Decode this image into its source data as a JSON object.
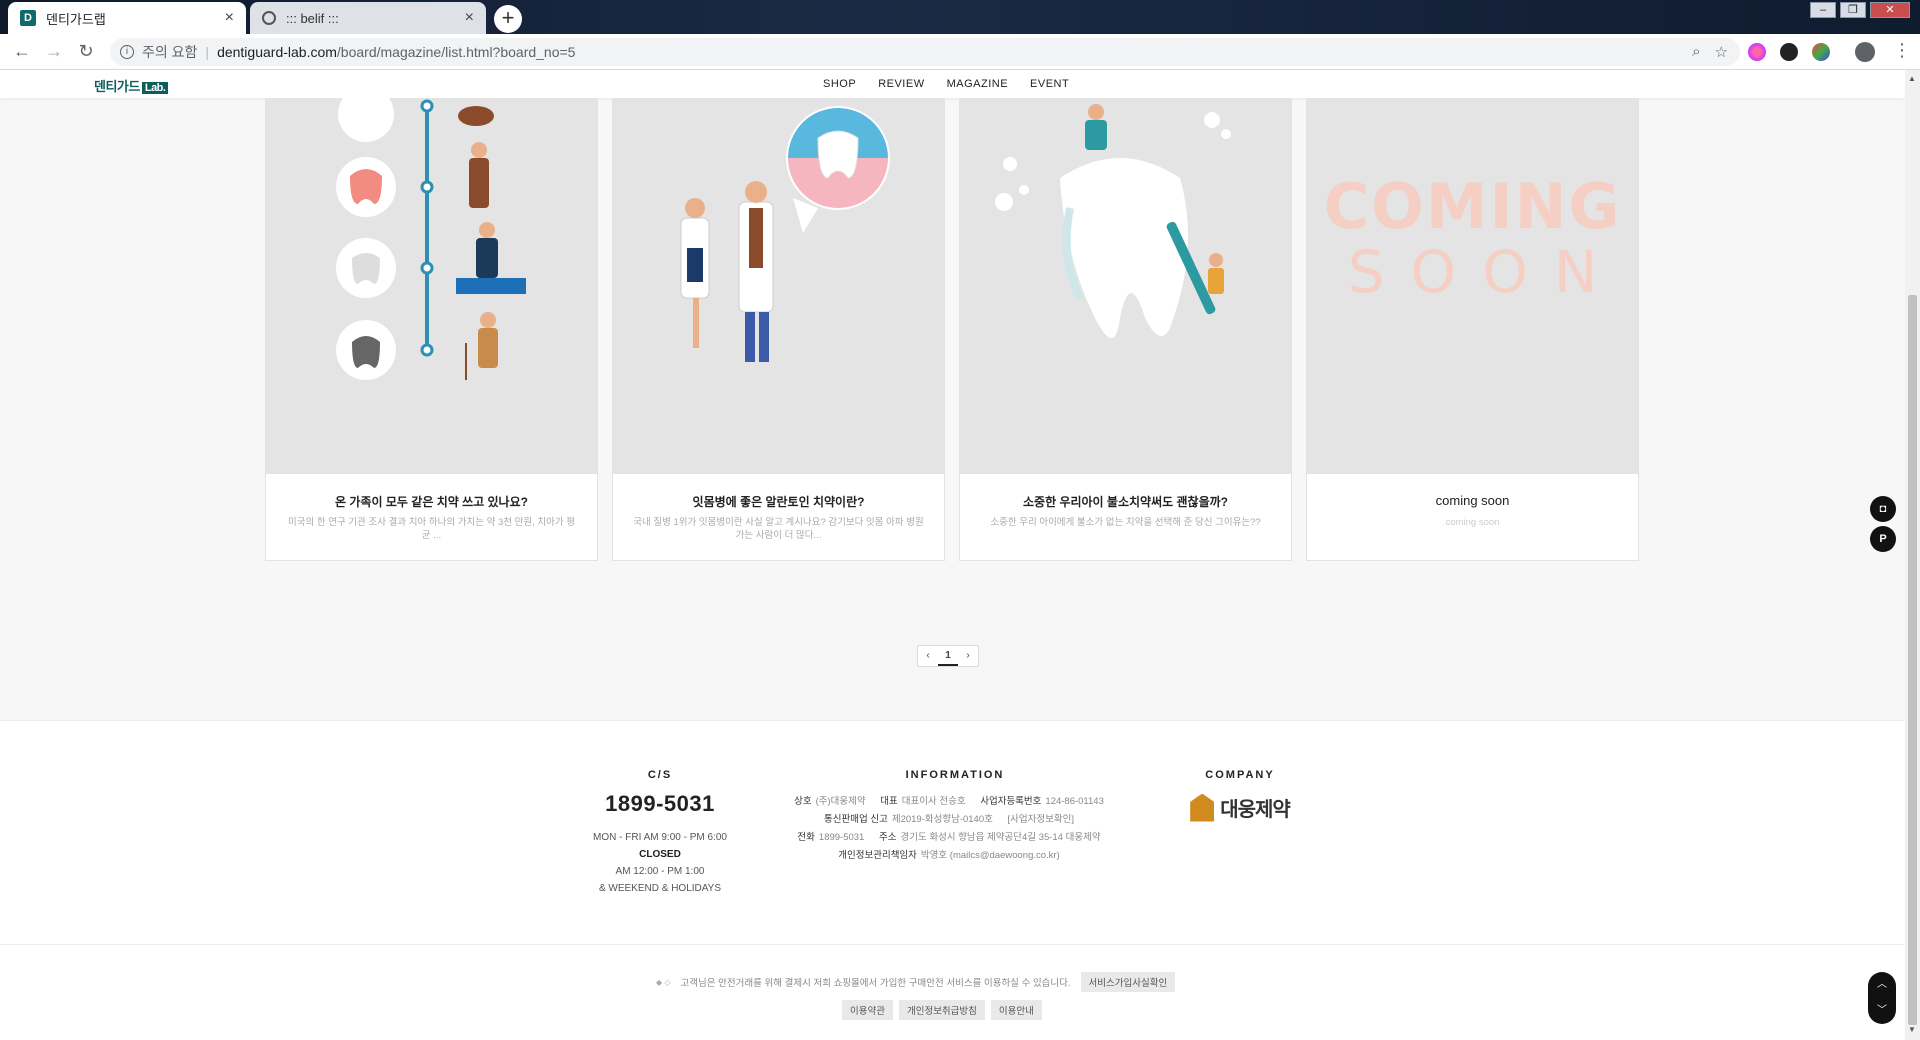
{
  "browser": {
    "tabs": [
      {
        "title": "덴티가드랩",
        "favicon": "D"
      },
      {
        "title": "::: belif :::"
      }
    ],
    "address": {
      "security_label": "주의 요함",
      "host": "dentiguard-lab.com",
      "path": "/board/magazine/list.html?board_no=5"
    }
  },
  "site": {
    "logo_text": "덴티가드",
    "logo_badge": "Lab.",
    "nav": [
      "SHOP",
      "REVIEW",
      "MAGAZINE",
      "EVENT"
    ]
  },
  "cards": [
    {
      "title": "온 가족이 모두 같은 치약 쓰고 있나요?",
      "desc": "미국의 한 연구 기관 조사 결과 치아 하나의 가치는 약 3천 만원, 치아가 평균 ..."
    },
    {
      "title": "잇몸병에 좋은 알란토인 치약이란?",
      "desc": "국내 질병 1위가 잇몸병이란 사실 알고 계시나요? 감기보다 잇몸 아파 병원 가는 사람이 더 많다..."
    },
    {
      "title": "소중한 우리아이 불소치약써도 괜찮을까?",
      "desc": "소중한 우리 아이에게 불소가 없는 치약을 선택해 준 당신 그이유는??"
    },
    {
      "title": "coming soon",
      "desc": "coming soon",
      "thumb_text_1": "COMING",
      "thumb_text_2": "SOON"
    }
  ],
  "pagination": {
    "prev": "‹",
    "current": "1",
    "next": "›"
  },
  "footer": {
    "cs": {
      "heading": "C/S",
      "phone": "1899-5031",
      "hours": "MON - FRI AM 9:00 - PM 6:00",
      "closed_label": "CLOSED",
      "lunch": "AM 12:00 - PM 1:00",
      "holidays": "& WEEKEND & HOLIDAYS"
    },
    "information": {
      "heading": "INFORMATION",
      "company_key": "상호",
      "company_val": "(주)대웅제약",
      "ceo_key": "대표",
      "ceo_val": "대표이사 전승호",
      "biz_key": "사업자등록번호",
      "biz_val": "124-86-01143",
      "mail_order_key": "통신판매업 신고",
      "mail_order_val": "제2019-화성향남-0140호",
      "biz_check": "[사업자정보확인]",
      "tel_key": "전화",
      "tel_val": "1899-5031",
      "addr_key": "주소",
      "addr_val": "경기도 화성시 향남읍 제약공단4길 35-14 대웅제약",
      "privacy_key": "개인정보관리책임자",
      "privacy_val": "박영호 (mailcs@daewoong.co.kr)"
    },
    "company": {
      "heading": "COMPANY",
      "name": "대웅제약"
    },
    "escrow_text": "고객님은 안전거래를 위해 결제시 저희 쇼핑몰에서 가입한 구매안전 서비스를 이용하실 수 있습니다.",
    "escrow_button": "서비스가입사실확인",
    "links": [
      "이용약관",
      "개인정보취급방침",
      "이용안내"
    ]
  }
}
